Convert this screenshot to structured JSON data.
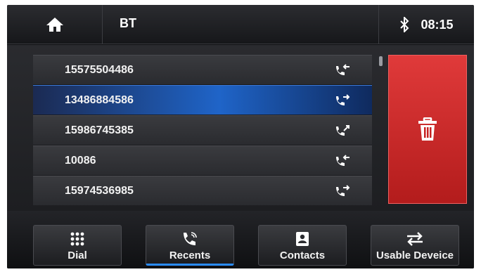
{
  "header": {
    "title": "BT",
    "home_icon": "home-icon",
    "bluetooth_icon": "bluetooth-icon",
    "time": "08:15"
  },
  "recents": [
    {
      "number": "15575504486",
      "type": "incoming",
      "icon": "incoming-call-icon"
    },
    {
      "number": "13486884586",
      "type": "outgoing",
      "icon": "outgoing-call-icon",
      "selected": true
    },
    {
      "number": "15986745385",
      "type": "missed",
      "icon": "missed-call-icon"
    },
    {
      "number": "10086",
      "type": "incoming",
      "icon": "incoming-call-icon"
    },
    {
      "number": "15974536985",
      "type": "outgoing",
      "icon": "outgoing-call-icon"
    }
  ],
  "delete": {
    "icon": "trash-icon",
    "color": "#d42a2a"
  },
  "nav": [
    {
      "label": "Dial",
      "icon": "dialpad-icon"
    },
    {
      "label": "Recents",
      "icon": "phone-wave-icon",
      "active": true
    },
    {
      "label": "Contacts",
      "icon": "contacts-icon"
    },
    {
      "label": "Usable Deveice",
      "icon": "swap-arrows-icon"
    }
  ],
  "colors": {
    "selected_row": "#1f64c8",
    "delete": "#d42a2a",
    "active_tab": "#2a8cff"
  }
}
